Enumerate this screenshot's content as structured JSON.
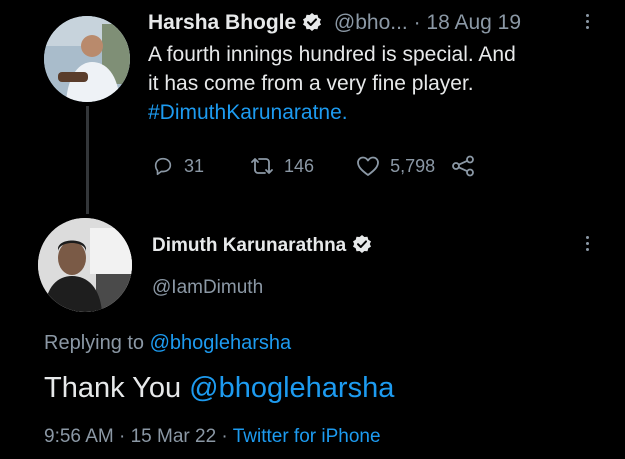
{
  "parent_tweet": {
    "author_name": "Harsha Bhogle",
    "handle": "@bho...",
    "date": "18 Aug 19",
    "lines": [
      "A fourth innings hundred is special. And",
      "it has come from a very fine player."
    ],
    "hashtag": "#DimuthKarunaratne.",
    "replies": "31",
    "retweets": "146",
    "likes": "5,798"
  },
  "reply_tweet": {
    "author_name": "Dimuth Karunarathna",
    "handle": "@IamDimuth",
    "replying_label": "Replying to ",
    "replying_to": "@bhogleharsha",
    "body_text": "Thank You ",
    "body_mention": "@bhogleharsha",
    "time": "9:56 AM",
    "date": "15 Mar 22",
    "source": "Twitter for iPhone",
    "separator": " · "
  },
  "colors": {
    "background": "#000000",
    "text": "#e7e9ea",
    "muted": "#8b98a5",
    "link": "#1d9bf0",
    "thread_line": "#333639"
  },
  "icons": {
    "verified": "verified-badge-icon",
    "reply": "reply-icon",
    "retweet": "retweet-icon",
    "like": "heart-icon",
    "share": "share-icon",
    "more": "more-vertical-icon"
  }
}
